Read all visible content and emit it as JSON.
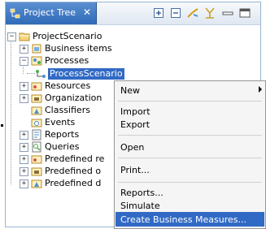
{
  "view": {
    "tab_title": "Project Tree",
    "tab_close": "✕",
    "toolbar_icons": [
      "expand-all-icon",
      "collapse-all-icon",
      "link-icon",
      "filter-icon",
      "minimize-icon",
      "maximize-icon"
    ]
  },
  "tree": {
    "root": "ProjectScenario",
    "business_items": "Business items",
    "processes": "Processes",
    "process_scenario": "ProcessScenario",
    "resources": "Resources",
    "organization": "Organization",
    "classifiers": "Classifiers",
    "events": "Events",
    "reports": "Reports",
    "queries": "Queries",
    "predefined_1": "Predefined re",
    "predefined_2": "Predefined o",
    "predefined_3": "Predefined d"
  },
  "context_menu": {
    "new": "New",
    "import": "Import",
    "export": "Export",
    "open": "Open",
    "print": "Print...",
    "reports": "Reports...",
    "simulate": "Simulate",
    "create_business_measures": "Create Business Measures..."
  },
  "colors": {
    "selection": "#316ac5",
    "tab": "#2f6ab8",
    "menu_bg": "#f5f5f5"
  }
}
